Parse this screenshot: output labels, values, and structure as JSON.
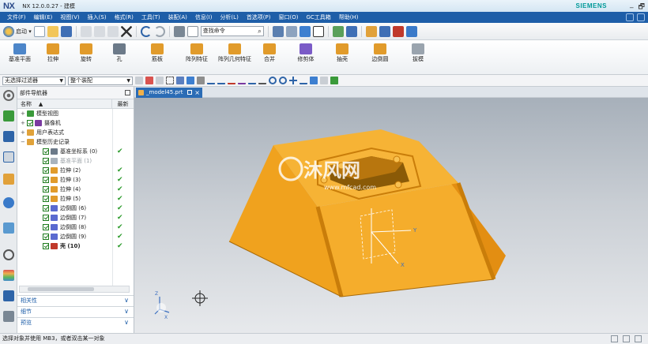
{
  "titlebar": {
    "logo": "NX",
    "title": "NX 12.0.0.27 - 建模",
    "brand": "SIEMENS",
    "minimize": "_",
    "restore": "🗗"
  },
  "menu": {
    "items": [
      "文件(F)",
      "编辑(E)",
      "视图(V)",
      "插入(S)",
      "格式(R)",
      "工具(T)",
      "装配(A)",
      "信息(I)",
      "分析(L)",
      "首选项(P)",
      "窗口(O)",
      "GC工具箱",
      "帮助(H)"
    ]
  },
  "toolbar": {
    "start_label": "启动 ▾",
    "command_search_placeholder": "查找命令",
    "search_icon_glyph": "⌕"
  },
  "ribbon": {
    "buttons": [
      {
        "label": "基准平面",
        "icon": "datum-plane-icon",
        "color": "#4d86c9"
      },
      {
        "label": "拉伸",
        "icon": "extrude-icon",
        "color": "#e19b2b"
      },
      {
        "label": "旋转",
        "icon": "revolve-icon",
        "color": "#e19b2b"
      },
      {
        "label": "孔",
        "icon": "hole-icon",
        "color": "#6c7a89"
      },
      {
        "label": "筋板",
        "icon": "rib-icon",
        "color": "#e19b2b"
      },
      {
        "label": "阵列特征",
        "icon": "pattern-feature-icon",
        "color": "#e19b2b"
      },
      {
        "label": "阵列几何特征",
        "icon": "pattern-geometry-icon",
        "color": "#e19b2b"
      },
      {
        "label": "合并",
        "icon": "unite-icon",
        "color": "#e19b2b"
      },
      {
        "label": "修剪体",
        "icon": "trim-body-icon",
        "color": "#7b5bc7"
      },
      {
        "label": "抽壳",
        "icon": "shell-icon",
        "color": "#e19b2b"
      },
      {
        "label": "边倒圆",
        "icon": "edge-blend-icon",
        "color": "#e19b2b"
      },
      {
        "label": "拔模",
        "icon": "draft-icon",
        "color": "#9aa4ae"
      }
    ]
  },
  "selection_bar": {
    "filter_value": "无选择过滤器",
    "assembly_value": "整个装配"
  },
  "navigator": {
    "title": "部件导航器",
    "col_name": "名称",
    "col_name_sort": "▲",
    "col_new": "最新",
    "rows": [
      {
        "label": "模型视图",
        "expand": "+",
        "icon_color": "#3a9a3a",
        "check": false,
        "ok": ""
      },
      {
        "label": "摄像机",
        "expand": "+",
        "icon_color": "#7a3aa0",
        "check": true,
        "ok": ""
      },
      {
        "label": "用户表达式",
        "expand": "+",
        "icon_color": "#e0a23a",
        "check": false,
        "ok": ""
      },
      {
        "label": "模型历史记录",
        "expand": "−",
        "icon_color": "#e0a23a",
        "check": false,
        "ok": ""
      },
      {
        "label": "基准坐标系 (0)",
        "expand": "",
        "icon_color": "#6c7a89",
        "check": true,
        "ok": "✔"
      },
      {
        "label": "基准平面 (1)",
        "expand": "",
        "icon_color": "#a9b3bd",
        "check": true,
        "ok": ""
      },
      {
        "label": "拉伸 (2)",
        "expand": "",
        "icon_color": "#e19b2b",
        "check": true,
        "ok": "✔"
      },
      {
        "label": "拉伸 (3)",
        "expand": "",
        "icon_color": "#e19b2b",
        "check": true,
        "ok": "✔"
      },
      {
        "label": "拉伸 (4)",
        "expand": "",
        "icon_color": "#e19b2b",
        "check": true,
        "ok": "✔"
      },
      {
        "label": "拉伸 (5)",
        "expand": "",
        "icon_color": "#e19b2b",
        "check": true,
        "ok": "✔"
      },
      {
        "label": "边倒圆 (6)",
        "expand": "",
        "icon_color": "#5a6ad0",
        "check": true,
        "ok": "✔"
      },
      {
        "label": "边倒圆 (7)",
        "expand": "",
        "icon_color": "#5a6ad0",
        "check": true,
        "ok": "✔"
      },
      {
        "label": "边倒圆 (8)",
        "expand": "",
        "icon_color": "#5a6ad0",
        "check": true,
        "ok": "✔"
      },
      {
        "label": "边倒圆 (9)",
        "expand": "",
        "icon_color": "#5a6ad0",
        "check": true,
        "ok": "✔"
      },
      {
        "label": "壳 (10)",
        "expand": "",
        "icon_color": "#c0392b",
        "check": true,
        "ok": "✔"
      }
    ],
    "panels": [
      {
        "label": "相关性",
        "chev": "∨"
      },
      {
        "label": "细节",
        "chev": "∨"
      },
      {
        "label": "预览",
        "chev": "∨"
      }
    ]
  },
  "graphics": {
    "tab_label": "_model45.prt",
    "tab_close": "×",
    "watermark_site": "沐风网",
    "watermark_url": "www.mfcad.com",
    "axis_x": "X",
    "axis_y": "Y",
    "axis_z": "Z",
    "model_color": "#f0a21e",
    "model_dark": "#c97d0a"
  },
  "status": {
    "text": "选择对象并使用 MB3，或者双击某一对象"
  }
}
